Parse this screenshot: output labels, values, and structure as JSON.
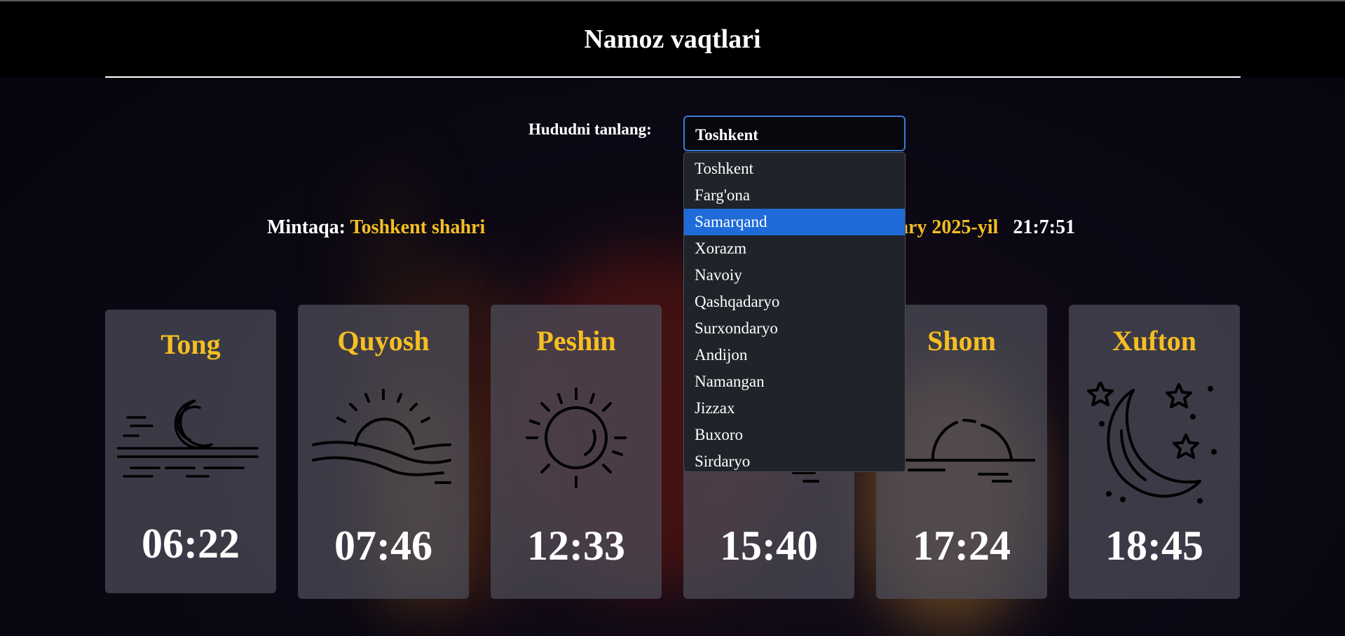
{
  "header": {
    "title": "Namoz vaqtlari"
  },
  "region": {
    "label": "Hududni tanlang:",
    "selected": "Toshkent",
    "options": [
      "Toshkent",
      "Farg'ona",
      "Samarqand",
      "Xorazm",
      "Navoiy",
      "Qashqadaryo",
      "Surxondaryo",
      "Andijon",
      "Namangan",
      "Jizzax",
      "Buxoro",
      "Sirdaryo"
    ],
    "highlighted": "Samarqand"
  },
  "info": {
    "mintaqa_label": "Mintaqa:",
    "mintaqa_value": "Toshkent shahri",
    "date_partial": "ary 2025-yil",
    "clock": "21:7:51"
  },
  "cards": [
    {
      "name": "Tong",
      "time": "06:22",
      "icon": "moonset-icon"
    },
    {
      "name": "Quyosh",
      "time": "07:46",
      "icon": "sunrise-icon"
    },
    {
      "name": "Peshin",
      "time": "12:33",
      "icon": "sun-icon"
    },
    {
      "name": "",
      "time": "15:40",
      "icon": "afternoon-icon"
    },
    {
      "name": "Shom",
      "time": "17:24",
      "icon": "sunset-icon"
    },
    {
      "name": "Xufton",
      "time": "18:45",
      "icon": "moon-stars-icon"
    }
  ],
  "colors": {
    "accent": "#f5bf22",
    "dropdown_highlight": "#1f6bd9",
    "card": "#4e4e5a"
  }
}
